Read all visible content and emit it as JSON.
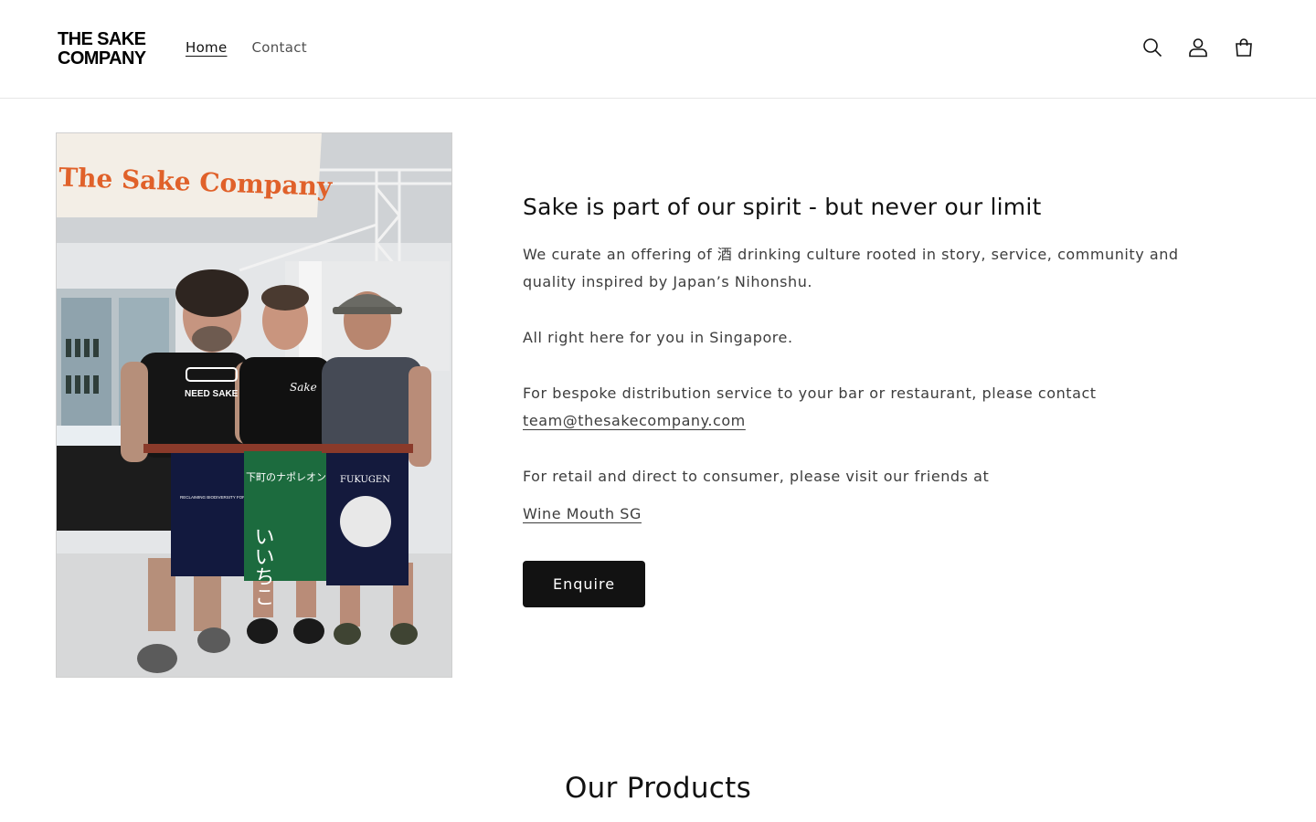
{
  "header": {
    "logo_line1": "THE SAKE",
    "logo_line2": "COMPANY",
    "nav": [
      {
        "label": "Home"
      },
      {
        "label": "Contact"
      }
    ],
    "icons": [
      "search-icon",
      "account-icon",
      "cart-icon"
    ]
  },
  "hero": {
    "photo": {
      "banner_text": "The Sake Company",
      "shirt_left": "NEED SAKE",
      "shirt_middle": "Sake",
      "apron_left": "RECLAIMING BIODIVERSITY FOR THE FUTURE OF SAKE",
      "apron_middle": "いいちこ",
      "apron_middle_top": "下町のナポレオン",
      "apron_right": "FUKUGEN"
    },
    "heading": "Sake is part of our spirit - but never our limit",
    "para1": "We curate an offering of 酒 drinking culture rooted in story, service, community and quality inspired by Japan’s Nihonshu.",
    "para2": "All right here for you in Singapore.",
    "para3": "For bespoke distribution service to your bar or restaurant, please contact",
    "email_link": "team@thesakecompany.com",
    "para4": "For retail and direct to consumer, please visit our friends at",
    "partner_link": "Wine Mouth SG",
    "button_label": "Enquire"
  },
  "products": {
    "title": "Our Products"
  },
  "colors": {
    "button_bg": "#121212",
    "text": "#121212",
    "body_text": "#3d3d3d",
    "banner_orange": "#e0612a"
  }
}
